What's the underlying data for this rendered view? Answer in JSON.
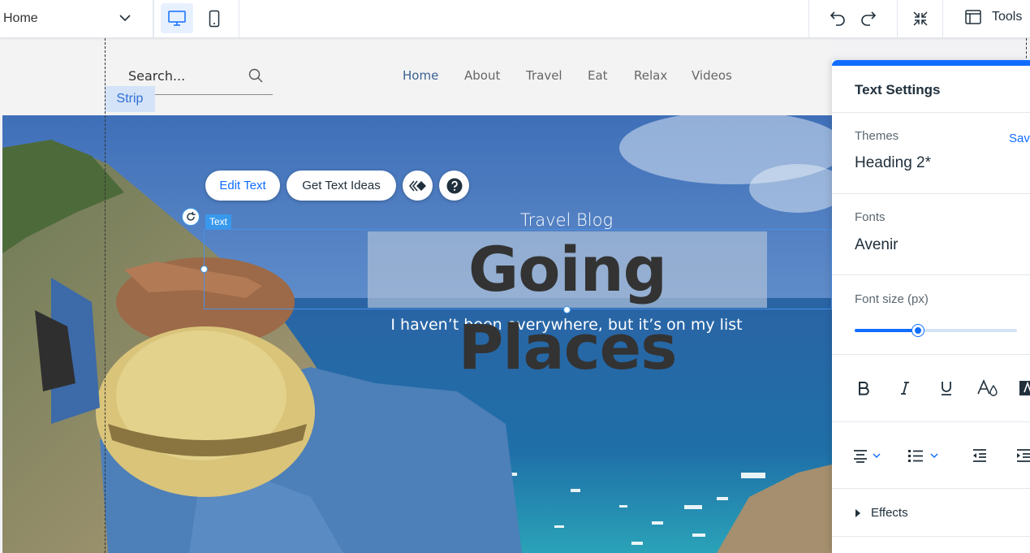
{
  "topbar": {
    "page_name": "Home",
    "tools_label": "Tools"
  },
  "site": {
    "search_placeholder": "Search...",
    "nav": [
      "Home",
      "About",
      "Travel",
      "Eat",
      "Relax",
      "Videos"
    ],
    "strip_label": "Strip"
  },
  "hero": {
    "edit_text_label": "Edit Text",
    "text_ideas_label": "Get Text Ideas",
    "text_tag": "Text",
    "blog_label": "Travel Blog",
    "headline": "Going Places",
    "subline": "I haven’t been everywhere, but it’s on my list"
  },
  "panel": {
    "title": "Text Settings",
    "themes_label": "Themes",
    "save_label": "Save",
    "theme_value": "Heading 2*",
    "fonts_label": "Fonts",
    "font_value": "Avenir",
    "font_size_label": "Font size (px)",
    "font_size_fraction": 0.39,
    "effects_label": "Effects"
  },
  "colors": {
    "accent": "#116dff",
    "selection": "#3899ec",
    "panel_bg": "#ffffff"
  }
}
